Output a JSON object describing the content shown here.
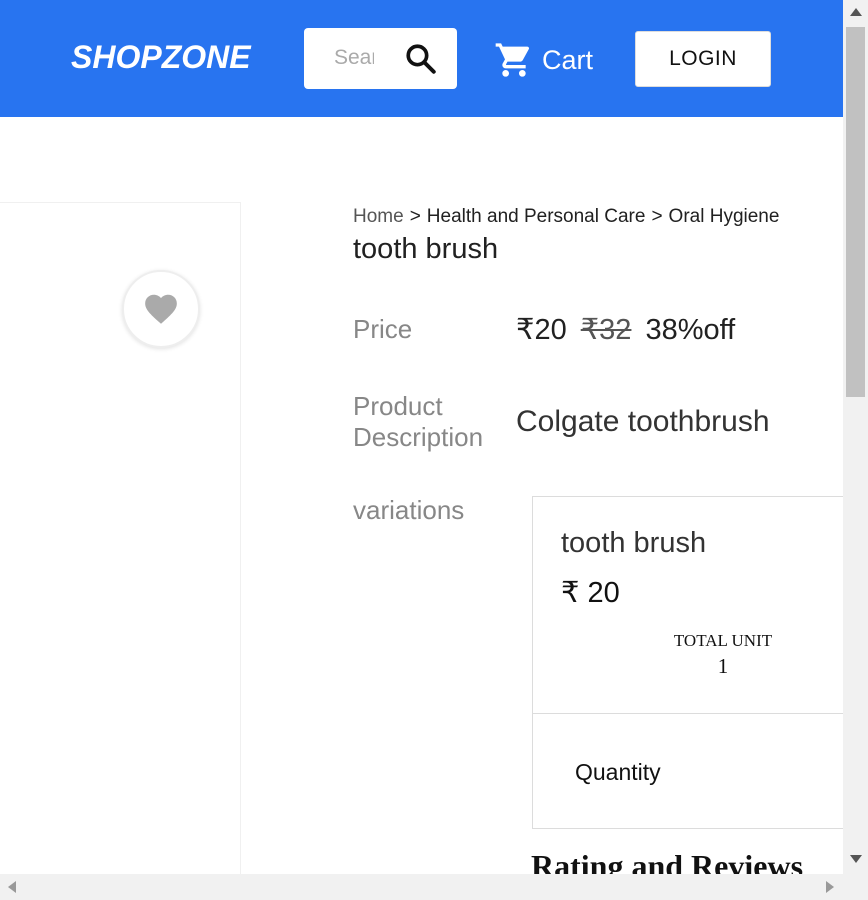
{
  "header": {
    "logo": "SHOPZONE",
    "search_placeholder": "Search",
    "search_icon": "search-icon",
    "cart_label": "Cart",
    "cart_icon": "cart-icon",
    "login_label": "LOGIN",
    "bg_color": "#2874f0"
  },
  "product": {
    "breadcrumb": [
      "Home",
      "Health and Personal Care",
      "Oral Hygiene"
    ],
    "breadcrumb_separator": ">",
    "title": "tooth brush",
    "price_label": "Price",
    "price": "₹20",
    "original_price": "₹32",
    "discount": "38%off",
    "description_label": "Product Description",
    "description": "Colgate toothbrush",
    "variations_label": "variations",
    "wishlist_icon": "heart-icon"
  },
  "variation": {
    "name": "tooth brush",
    "price": "₹ 20",
    "total_unit_label": "TOTAL UNIT",
    "total_unit_value": "1",
    "quantity_label": "Quantity"
  },
  "reviews": {
    "heading": "Rating and Reviews"
  }
}
